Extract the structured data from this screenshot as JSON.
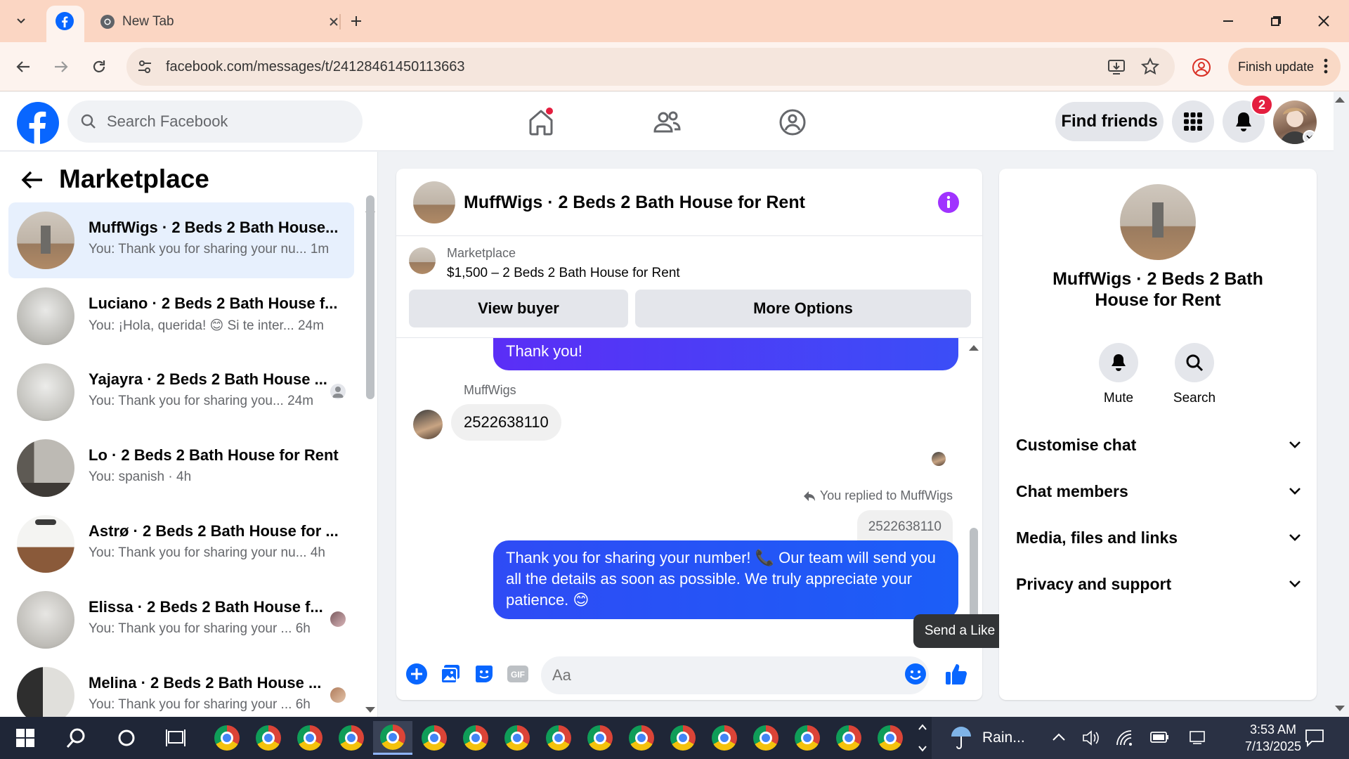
{
  "browser": {
    "tabs": [
      {
        "label": "",
        "icon": "facebook-icon",
        "active": true
      },
      {
        "label": "New Tab",
        "icon": "chrome-icon",
        "active": false
      }
    ],
    "url": "facebook.com/messages/t/24128461450113663",
    "finish_update": "Finish update"
  },
  "fb": {
    "search_placeholder": "Search Facebook",
    "find_friends": "Find friends",
    "notif_count": "2"
  },
  "left": {
    "title": "Marketplace",
    "conversations": [
      {
        "name": "MuffWigs · 2 Beds 2 Bath House...",
        "preview": "You: Thank you for sharing your nu...",
        "time": "1m",
        "active": true
      },
      {
        "name": "Luciano · 2 Beds 2 Bath House f...",
        "preview": "You: ¡Hola, querida! 😊 Si te inter...",
        "time": "24m"
      },
      {
        "name": "Yajayra · 2 Beds 2 Bath House ...",
        "preview": "You: Thank you for sharing you...",
        "time": "24m"
      },
      {
        "name": "Lo · 2 Beds 2 Bath House for Rent",
        "preview": "You: spanish",
        "time": "4h"
      },
      {
        "name": "Astrø · 2 Beds 2 Bath House for ...",
        "preview": "You: Thank you for sharing your nu...",
        "time": "4h"
      },
      {
        "name": "Elissa · 2 Beds 2 Bath House f...",
        "preview": "You: Thank you for sharing your ...",
        "time": "6h"
      },
      {
        "name": "Melina · 2 Beds 2 Bath House ...",
        "preview": "You: Thank you for sharing your ...",
        "time": "6h"
      }
    ]
  },
  "chat": {
    "title": "MuffWigs · 2 Beds 2 Bath House for Rent",
    "marketplace_label": "Marketplace",
    "item": "$1,500 – 2 Beds 2 Bath House for Rent",
    "view_buyer": "View buyer",
    "more_options": "More Options",
    "messages": {
      "out_1": "Thank you!",
      "sender": "MuffWigs",
      "in_1": "2522638110",
      "replied_to": "You replied to MuffWigs",
      "quoted": "2522638110",
      "out_2": "Thank you for sharing your number! 📞 Our team will send you all the details as soon as possible. We truly appreciate your patience. 😊"
    },
    "input_placeholder": "Aa",
    "tooltip": "Send a Like"
  },
  "right": {
    "name": "MuffWigs · 2 Beds 2 Bath House for Rent",
    "mute": "Mute",
    "search": "Search",
    "sections": [
      "Customise chat",
      "Chat members",
      "Media, files and links",
      "Privacy and support"
    ]
  },
  "taskbar": {
    "weather": "Rain...",
    "time": "3:53 AM",
    "date": "7/13/2025"
  },
  "colors": {
    "fb_blue": "#0866ff",
    "messenger_purple": "#5b2ef6",
    "notification_red": "#e41e3f",
    "info_purple": "#a033ff"
  }
}
